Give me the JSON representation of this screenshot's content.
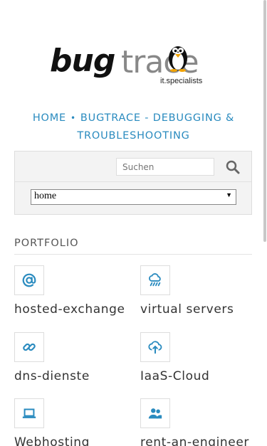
{
  "logo": {
    "word_bold": "bug",
    "word_light": "trace",
    "tagline": "it.specialists"
  },
  "breadcrumb": {
    "home": "HOME",
    "separator": "•",
    "current": "BUGTRACE - DEBUGGING & TROUBLESHOOTING"
  },
  "search": {
    "placeholder": "Suchen",
    "icon": "search-icon"
  },
  "nav_select": {
    "selected": "home",
    "arrow": "▼"
  },
  "portfolio": {
    "title": "PORTFOLIO",
    "items": [
      {
        "label": "hosted-exchange",
        "icon": "at-sign-icon"
      },
      {
        "label": "virtual servers",
        "icon": "cloud-rain-icon"
      },
      {
        "label": "dns-dienste",
        "icon": "link-icon"
      },
      {
        "label": "IaaS-Cloud",
        "icon": "cloud-upload-icon"
      },
      {
        "label": "Webhosting",
        "icon": "laptop-icon"
      },
      {
        "label": "rent-an-engineer",
        "icon": "users-icon"
      }
    ]
  },
  "colors": {
    "accent": "#2a8bbf",
    "text": "#333333",
    "panel": "#f3f3f3"
  }
}
